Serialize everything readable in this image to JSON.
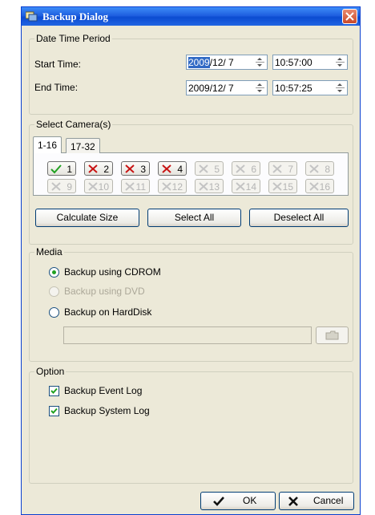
{
  "dialog": {
    "title": "Backup Dialog"
  },
  "date_time_period": {
    "legend": "Date Time Period",
    "start_label": "Start Time:",
    "start_date_selected": "2009",
    "start_date_rest": "/12/ 7",
    "start_time": "10:57:00",
    "end_label": "End Time:",
    "end_date": "2009/12/ 7",
    "end_time": "10:57:25"
  },
  "select_cameras": {
    "legend": "Select Camera(s)",
    "tabs": [
      "1-16",
      "17-32"
    ],
    "cameras": [
      {
        "num": "1",
        "state": "checked"
      },
      {
        "num": "2",
        "state": "unchecked"
      },
      {
        "num": "3",
        "state": "unchecked"
      },
      {
        "num": "4",
        "state": "unchecked"
      },
      {
        "num": "5",
        "state": "disabled"
      },
      {
        "num": "6",
        "state": "disabled"
      },
      {
        "num": "7",
        "state": "disabled"
      },
      {
        "num": "8",
        "state": "disabled"
      },
      {
        "num": "9",
        "state": "disabled"
      },
      {
        "num": "10",
        "state": "disabled"
      },
      {
        "num": "11",
        "state": "disabled"
      },
      {
        "num": "12",
        "state": "disabled"
      },
      {
        "num": "13",
        "state": "disabled"
      },
      {
        "num": "14",
        "state": "disabled"
      },
      {
        "num": "15",
        "state": "disabled"
      },
      {
        "num": "16",
        "state": "disabled"
      }
    ],
    "calculate_size": "Calculate Size",
    "select_all": "Select All",
    "deselect_all": "Deselect All"
  },
  "media": {
    "legend": "Media",
    "cdrom": "Backup using CDROM",
    "dvd": "Backup using DVD",
    "harddisk": "Backup on HardDisk",
    "selected": "cdrom",
    "path_value": ""
  },
  "option": {
    "legend": "Option",
    "event_log": "Backup Event Log",
    "system_log": "Backup System Log",
    "event_log_checked": true,
    "system_log_checked": true
  },
  "footer": {
    "ok": "OK",
    "cancel": "Cancel"
  },
  "colors": {
    "title_bar": "#0b4bd1",
    "window_bg": "#ece9d8",
    "check_green": "#21a121",
    "cross_red": "#c81414"
  }
}
